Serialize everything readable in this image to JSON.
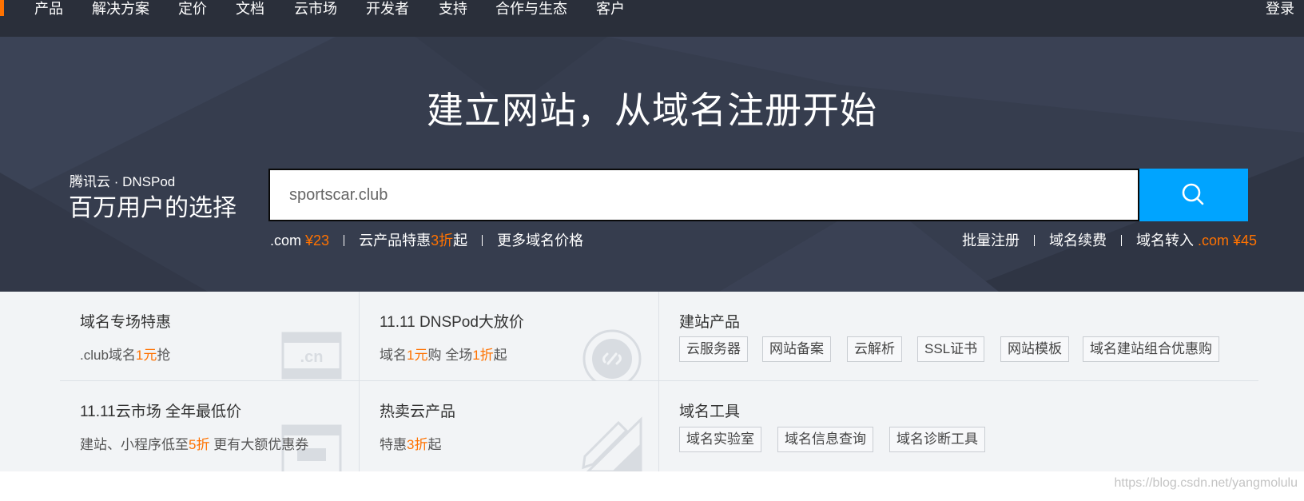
{
  "nav": {
    "items": [
      "产品",
      "解决方案",
      "定价",
      "文档",
      "云市场",
      "开发者",
      "支持",
      "合作与生态",
      "客户"
    ],
    "login": "登录"
  },
  "hero": {
    "title": "建立网站，从域名注册开始",
    "brand_small": "腾讯云 · DNSPod",
    "brand_big": "百万用户的选择",
    "search_value": "sportscar.club",
    "left_links": {
      "com_prefix": ".com",
      "com_price": "¥23",
      "cloud_prefix": "云产品特惠",
      "cloud_discount": "3折",
      "cloud_suffix": "起",
      "more": "更多域名价格"
    },
    "right_links": {
      "batch": "批量注册",
      "renew": "域名续费",
      "transfer_prefix": "域名转入",
      "transfer_price": ".com ¥45"
    }
  },
  "cards": {
    "c1": {
      "title": "域名专场特惠",
      "sub_prefix": ".club域名",
      "sub_highlight": "1元",
      "sub_suffix": "抢"
    },
    "c2": {
      "title": "11.11 DNSPod大放价",
      "sub_a": "域名",
      "sub_b": "1元",
      "sub_c": "购 全场",
      "sub_d": "1折",
      "sub_e": "起"
    },
    "c3": {
      "title": "11.11云市场 全年最低价",
      "sub_prefix": "建站、小程序低至",
      "sub_highlight": "5折",
      "sub_suffix": " 更有大额优惠券"
    },
    "c4": {
      "title": "热卖云产品",
      "sub_prefix": "特惠",
      "sub_highlight": "3折",
      "sub_suffix": "起"
    },
    "build": {
      "title": "建站产品",
      "tags": [
        "云服务器",
        "网站备案",
        "云解析",
        "SSL证书",
        "网站模板",
        "域名建站组合优惠购"
      ]
    },
    "tools": {
      "title": "域名工具",
      "tags": [
        "域名实验室",
        "域名信息查询",
        "域名诊断工具"
      ]
    },
    "deco_text": ".cn"
  },
  "watermark": "https://blog.csdn.net/yangmolulu",
  "colors": {
    "nav_bg": "#2a2f3a",
    "hero_bg": "#363d4e",
    "accent": "#ff7200",
    "search_btn": "#00a4ff",
    "cards_bg": "#f2f4f6"
  },
  "icons": [
    "search-icon",
    "link-icon",
    "ruler-pencil-icon",
    "cn-domain-icon",
    "store-icon"
  ]
}
